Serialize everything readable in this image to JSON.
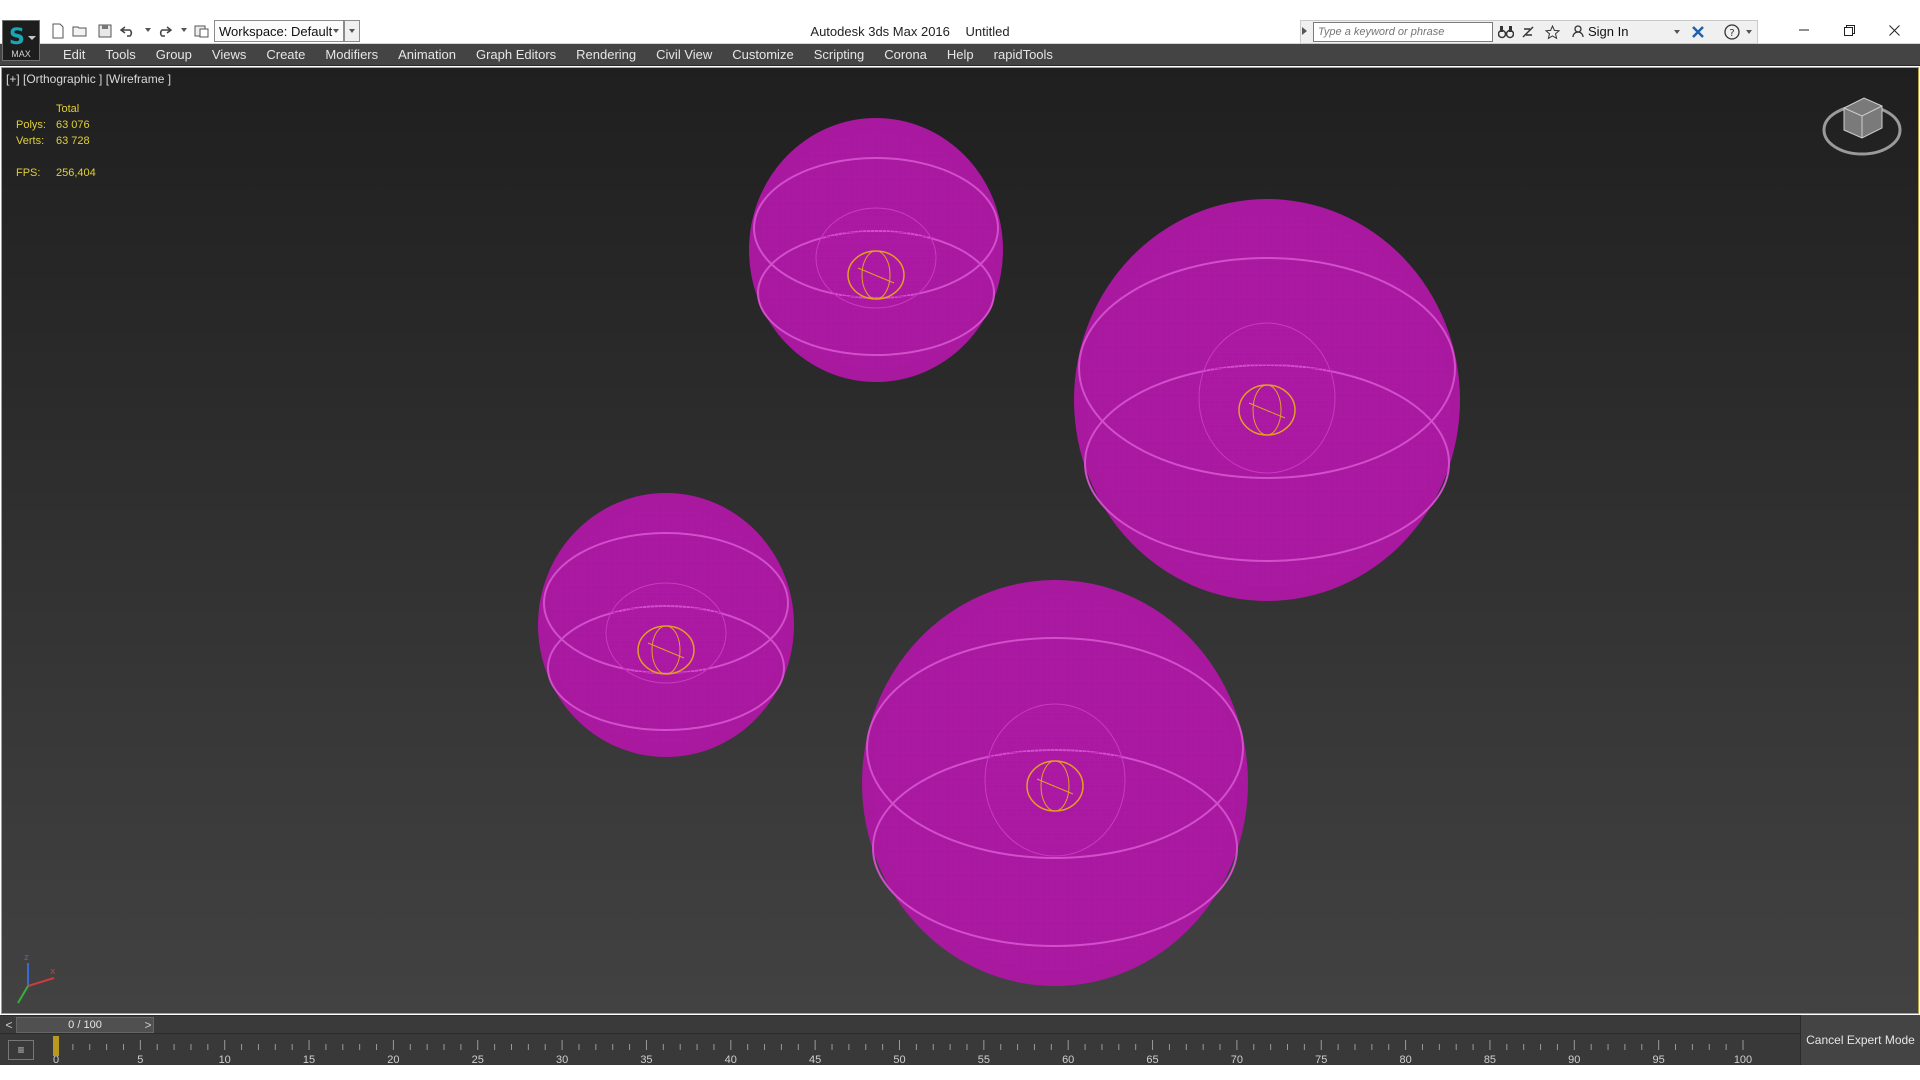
{
  "app": {
    "logo_text": "MAX",
    "title": "Autodesk 3ds Max 2016",
    "document": "Untitled"
  },
  "quick_access": {
    "workspace_label": "Workspace: Default",
    "icons": [
      "new-file-icon",
      "open-file-icon",
      "save-icon",
      "undo-icon",
      "redo-icon",
      "project-folder-icon"
    ]
  },
  "search": {
    "placeholder": "Type a keyword or phrase"
  },
  "account": {
    "sign_in": "Sign In"
  },
  "menu": {
    "items": [
      "Edit",
      "Tools",
      "Group",
      "Views",
      "Create",
      "Modifiers",
      "Animation",
      "Graph Editors",
      "Rendering",
      "Civil View",
      "Customize",
      "Scripting",
      "Corona",
      "Help",
      "rapidTools"
    ]
  },
  "viewport": {
    "label": "[+] [Orthographic ] [Wireframe ]",
    "stats": {
      "header": "Total",
      "polys_label": "Polys:",
      "polys_value": "63 076",
      "verts_label": "Verts:",
      "verts_value": "63 728",
      "fps_label": "FPS:",
      "fps_value": "256,404"
    },
    "wire_color": "#b01aa8",
    "pivot_color": "#e0a020"
  },
  "timeline": {
    "position": "0 / 100",
    "prev": "<",
    "next": ">",
    "current_frame": 0,
    "total_frames": 100,
    "labels": [
      "0",
      "5",
      "10",
      "15",
      "20",
      "25",
      "30",
      "35",
      "40",
      "45",
      "50",
      "55",
      "60",
      "65",
      "70",
      "75",
      "80",
      "85",
      "90",
      "95",
      "100"
    ]
  },
  "status": {
    "expert_mode": "Cancel Expert Mode"
  }
}
